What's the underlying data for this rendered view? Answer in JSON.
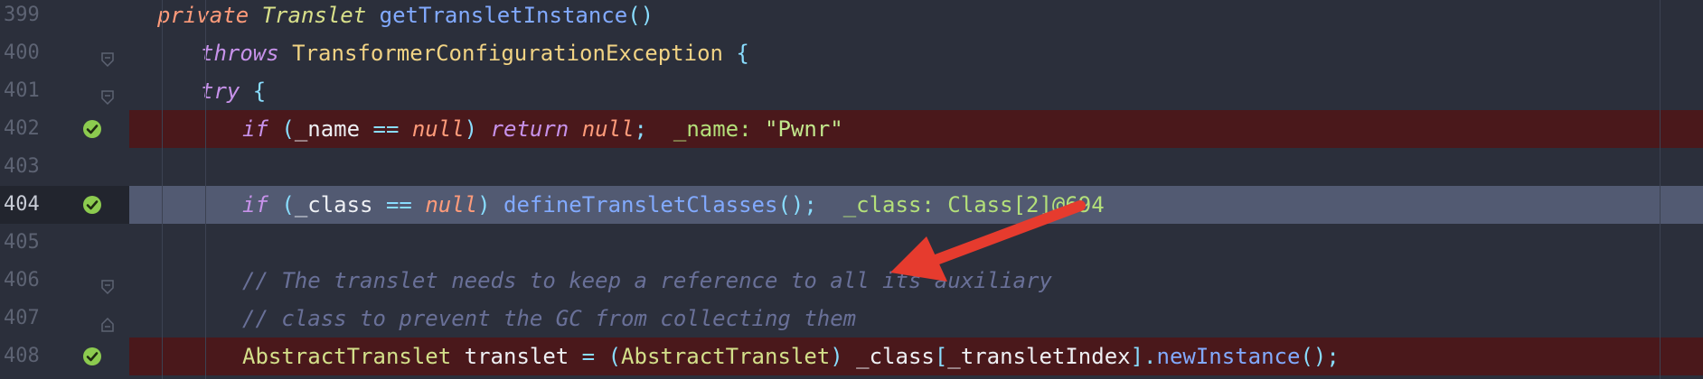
{
  "editor": {
    "lines": [
      {
        "num": "399",
        "tokens": [
          {
            "t": "private",
            "c": "kw2"
          },
          {
            "t": " ",
            "c": "id"
          },
          {
            "t": "Translet",
            "c": "typei"
          },
          {
            "t": " ",
            "c": "id"
          },
          {
            "t": "getTransletInstance",
            "c": "fn"
          },
          {
            "t": "()",
            "c": "punc"
          }
        ]
      },
      {
        "num": "400",
        "tokens": [
          {
            "t": "throws",
            "c": "kw"
          },
          {
            "t": " ",
            "c": "id"
          },
          {
            "t": "TransformerConfigurationException",
            "c": "type"
          },
          {
            "t": " {",
            "c": "punc"
          }
        ]
      },
      {
        "num": "401",
        "tokens": [
          {
            "t": "try",
            "c": "kw"
          },
          {
            "t": " {",
            "c": "punc"
          }
        ]
      },
      {
        "num": "402",
        "tokens": [
          {
            "t": "if",
            "c": "kw"
          },
          {
            "t": " (",
            "c": "punc"
          },
          {
            "t": "_name",
            "c": "id"
          },
          {
            "t": " == ",
            "c": "op"
          },
          {
            "t": "null",
            "c": "nul"
          },
          {
            "t": ") ",
            "c": "punc"
          },
          {
            "t": "return",
            "c": "kw"
          },
          {
            "t": " ",
            "c": "id"
          },
          {
            "t": "null",
            "c": "nul"
          },
          {
            "t": ";",
            "c": "punc"
          },
          {
            "t": "  _name: ",
            "c": "dbg"
          },
          {
            "t": "\"Pwnr\"",
            "c": "str"
          }
        ]
      },
      {
        "num": "403",
        "tokens": []
      },
      {
        "num": "404",
        "tokens": [
          {
            "t": "if",
            "c": "kw"
          },
          {
            "t": " (",
            "c": "punc"
          },
          {
            "t": "_class",
            "c": "id"
          },
          {
            "t": " == ",
            "c": "op"
          },
          {
            "t": "null",
            "c": "nul"
          },
          {
            "t": ") ",
            "c": "punc"
          },
          {
            "t": "defineTransletClasses",
            "c": "fn"
          },
          {
            "t": "();",
            "c": "punc"
          },
          {
            "t": "  _class: Class[2]@694",
            "c": "dbg"
          }
        ]
      },
      {
        "num": "405",
        "tokens": []
      },
      {
        "num": "406",
        "tokens": [
          {
            "t": "// The translet needs to keep a reference to all its auxiliary",
            "c": "cmt"
          }
        ]
      },
      {
        "num": "407",
        "tokens": [
          {
            "t": "// class to prevent the GC from collecting them",
            "c": "cmt"
          }
        ]
      },
      {
        "num": "408",
        "tokens": [
          {
            "t": "AbstractTranslet",
            "c": "cls"
          },
          {
            "t": " ",
            "c": "id"
          },
          {
            "t": "translet",
            "c": "id"
          },
          {
            "t": " = ",
            "c": "op"
          },
          {
            "t": "(",
            "c": "punc"
          },
          {
            "t": "AbstractTranslet",
            "c": "cls"
          },
          {
            "t": ") ",
            "c": "punc"
          },
          {
            "t": "_class",
            "c": "id"
          },
          {
            "t": "[",
            "c": "punc"
          },
          {
            "t": "_transletIndex",
            "c": "id"
          },
          {
            "t": "]",
            "c": "punc"
          },
          {
            "t": ".",
            "c": "punc"
          },
          {
            "t": "newInstance",
            "c": "fn"
          },
          {
            "t": "();",
            "c": "punc"
          }
        ]
      }
    ],
    "breakpoint_color": "#4a181b",
    "current_line_color": "#525a72",
    "arrow_color": "#e63b2e"
  }
}
